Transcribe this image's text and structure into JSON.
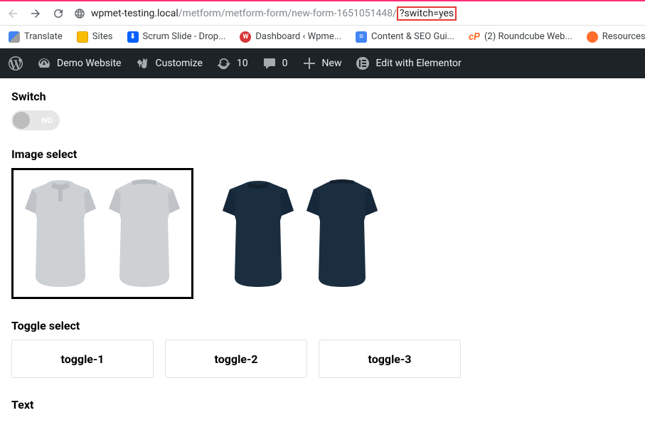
{
  "browser": {
    "url_host": "wpmet-testing.local",
    "url_path": "/metform/metform-form/new-form-1651051448/",
    "url_query_highlighted": "?switch=yes",
    "bookmarks": [
      {
        "label": "Translate",
        "color": "#4285f4"
      },
      {
        "label": "Sites",
        "color": "#fbbc04"
      },
      {
        "label": "Scrum Slide - Drop...",
        "color": "#0061ff"
      },
      {
        "label": "Dashboard ‹ Wpme...",
        "color": "#d63638"
      },
      {
        "label": "Content & SEO Gui...",
        "color": "#4285f4"
      },
      {
        "label": "(2) Roundcube Web...",
        "color": "#ff6c2c"
      },
      {
        "label": "Resources Docs | Ni...",
        "color": "#ff6c2c"
      }
    ]
  },
  "adminbar": {
    "site_name": "Demo Website",
    "customize": "Customize",
    "updates_count": "10",
    "comments_count": "0",
    "new": "New",
    "edit_elementor": "Edit with Elementor"
  },
  "form": {
    "switch": {
      "label": "Switch",
      "state_text": "NO"
    },
    "image_select": {
      "label": "Image select",
      "selected_index": 0
    },
    "toggle_select": {
      "label": "Toggle select",
      "options": [
        "toggle-1",
        "toggle-2",
        "toggle-3"
      ]
    },
    "text": {
      "label": "Text"
    }
  }
}
